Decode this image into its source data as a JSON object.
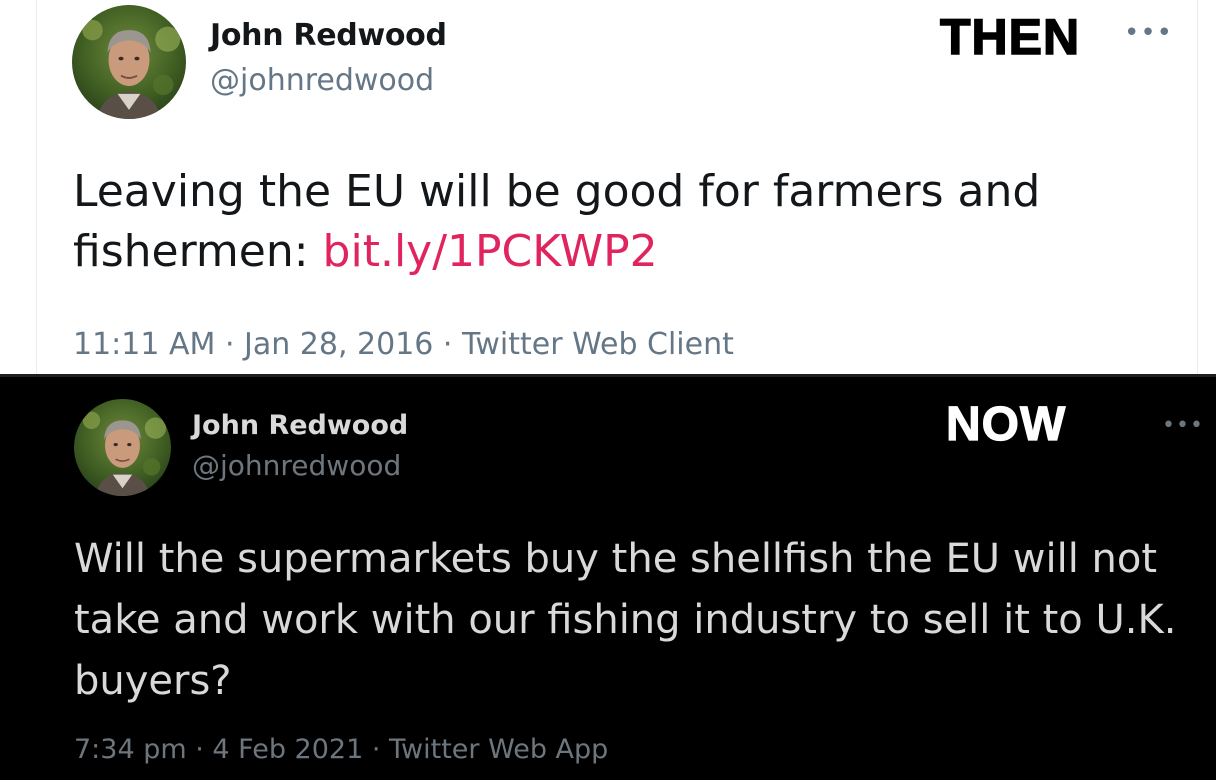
{
  "then_tweet": {
    "stamp": "THEN",
    "author_name": "John Redwood",
    "author_handle": "@johnredwood",
    "more_icon": "more-horizontal-icon",
    "text": "Leaving the EU will be good for farmers and fishermen: ",
    "link": "bit.ly/1PCKWP2",
    "time": "11:11 AM",
    "date": "Jan 28, 2016",
    "source": "Twitter Web Client",
    "separator": " · ",
    "colors": {
      "background": "#ffffff",
      "link": "#e0245e",
      "text": "#14171a",
      "muted": "#657786"
    }
  },
  "now_tweet": {
    "stamp": "NOW",
    "author_name": "John Redwood",
    "author_handle": "@johnredwood",
    "more_icon": "more-horizontal-icon",
    "text": "Will the supermarkets buy the shellfish the EU will not take and work with our fishing industry to sell it to U.K. buyers?",
    "time": "7:34 pm",
    "date": "4 Feb 2021",
    "source": "Twitter Web App",
    "separator": " · ",
    "colors": {
      "background": "#000000",
      "text": "#d9d9d9",
      "muted": "#6e767d"
    }
  }
}
